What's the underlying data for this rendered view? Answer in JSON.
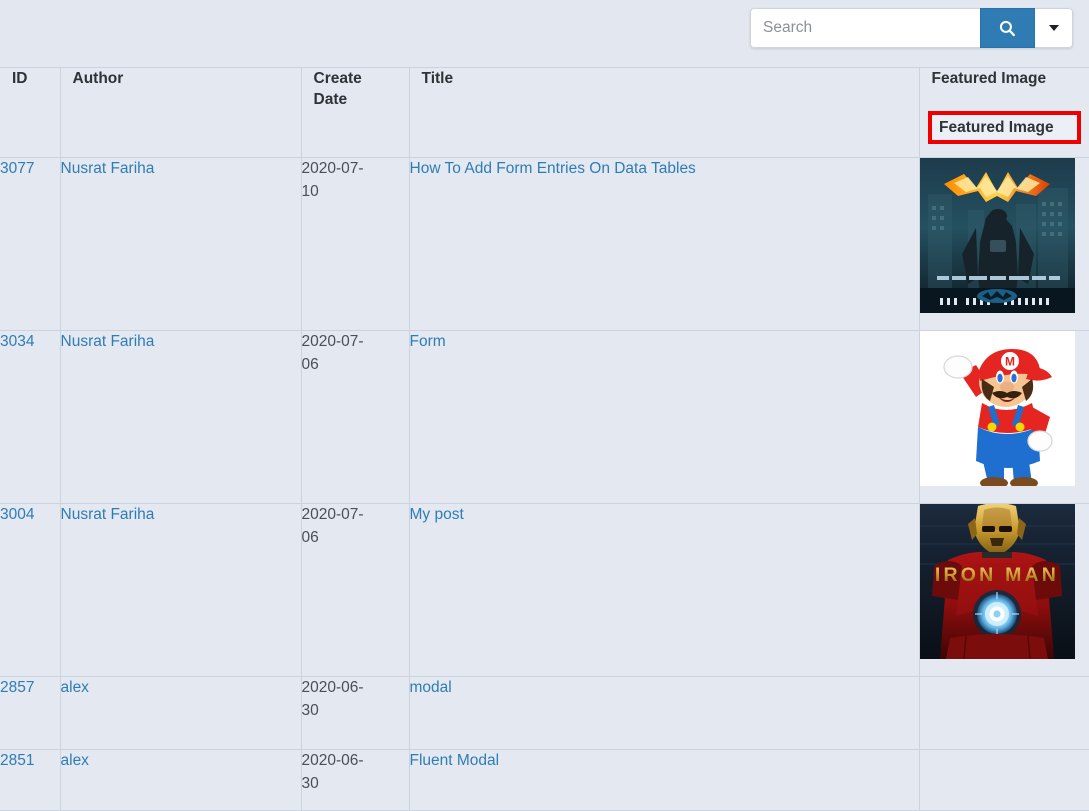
{
  "search": {
    "placeholder": "Search",
    "value": "",
    "submit_icon": "search-icon",
    "dropdown_icon": "chevron-down-icon",
    "submit_color": "#2f7cb5"
  },
  "theme": {
    "page_background": "#e2e7f0",
    "cell_background": "#e4e9f1",
    "border": "#cdd3de",
    "link": "#2f7cb5",
    "text": "#3b4045",
    "header_text": "#2f3337",
    "highlight": "#ee0000"
  },
  "table": {
    "columns": [
      {
        "key": "id",
        "label": "ID"
      },
      {
        "key": "author",
        "label": "Author"
      },
      {
        "key": "date",
        "label": "Create\nDate",
        "label_line1": "Create",
        "label_line2": "Date"
      },
      {
        "key": "title",
        "label": "Title"
      },
      {
        "key": "image",
        "label": "Featured Image",
        "highlighted": true
      }
    ],
    "rows": [
      {
        "id": "3077",
        "author": "Nusrat Fariha",
        "date_line1": "2020-07-",
        "date_line2": "10",
        "title": "How To Add Form Entries On Data Tables",
        "image": "the-dark-knight-poster-thumbnail",
        "image_caption": "THE DARK KNIGHT"
      },
      {
        "id": "3034",
        "author": "Nusrat Fariha",
        "date_line1": "2020-07-",
        "date_line2": "06",
        "title": "Form",
        "image": "super-mario-thumbnail",
        "image_caption": ""
      },
      {
        "id": "3004",
        "author": "Nusrat Fariha",
        "date_line1": "2020-07-",
        "date_line2": "06",
        "title": "My post",
        "image": "iron-man-poster-thumbnail",
        "image_caption": "IRON MAN"
      },
      {
        "id": "2857",
        "author": "alex",
        "date_line1": "2020-06-",
        "date_line2": "30",
        "title": "modal",
        "image": "",
        "image_caption": ""
      },
      {
        "id": "2851",
        "author": "alex",
        "date_line1": "2020-06-",
        "date_line2": "30",
        "title": "Fluent Modal",
        "image": "",
        "image_caption": ""
      }
    ]
  },
  "highlight_annotation": {
    "target": "Featured Image",
    "label": "Featured Image"
  }
}
